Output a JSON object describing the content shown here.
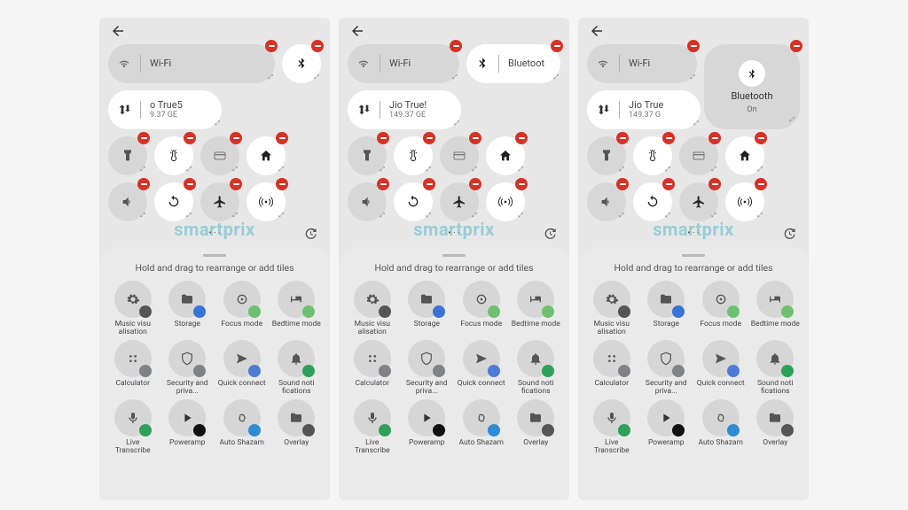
{
  "watermark": "smartprix",
  "hint": "Hold and drag to rearrange or add tiles",
  "screens": [
    {
      "wifi": "Wi-Fi",
      "bluetooth_variant": "circle",
      "bluetooth_label": "",
      "data_label": "o True5",
      "data_sub": "9.37 GE"
    },
    {
      "wifi": "Wi-Fi",
      "bluetooth_variant": "pill",
      "bluetooth_label": "Bluetoot",
      "data_label": "Jio True!",
      "data_sub": "149.37 GE"
    },
    {
      "wifi": "Wi-Fi",
      "bluetooth_variant": "big",
      "bluetooth_label": "Bluetooth",
      "bluetooth_sub": "On",
      "data_label": "Jio True",
      "data_sub": "149.37 G"
    }
  ],
  "tray": [
    {
      "label": "Music visu alisation",
      "icon": "gear",
      "badge": "#555"
    },
    {
      "label": "Storage",
      "icon": "folder",
      "badge": "#3a73d8"
    },
    {
      "label": "Focus mode",
      "icon": "focus",
      "badge": "#6fbf73"
    },
    {
      "label": "Bedtime mode",
      "icon": "bed",
      "badge": "#6fbf73"
    },
    {
      "label": "Calculator",
      "icon": "grid4",
      "badge": "#808285"
    },
    {
      "label": "Security and priva...",
      "icon": "shield",
      "badge": "#808285"
    },
    {
      "label": "Quick connect",
      "icon": "send",
      "badge": "#4e7bd8"
    },
    {
      "label": "Sound noti fications",
      "icon": "bell",
      "badge": "#2fa05a"
    },
    {
      "label": "Live Transcribe",
      "icon": "mic",
      "badge": "#2fa05a"
    },
    {
      "label": "Poweramp",
      "icon": "play",
      "badge": "#111"
    },
    {
      "label": "Auto Shazam",
      "icon": "shazam",
      "badge": "#2e8bd6"
    },
    {
      "label": "Overlay",
      "icon": "folder",
      "badge": "#555"
    }
  ],
  "qs_icons": [
    "flashlight",
    "thermo",
    "card",
    "home",
    "volume",
    "rotate",
    "airplane",
    "hotspot"
  ]
}
